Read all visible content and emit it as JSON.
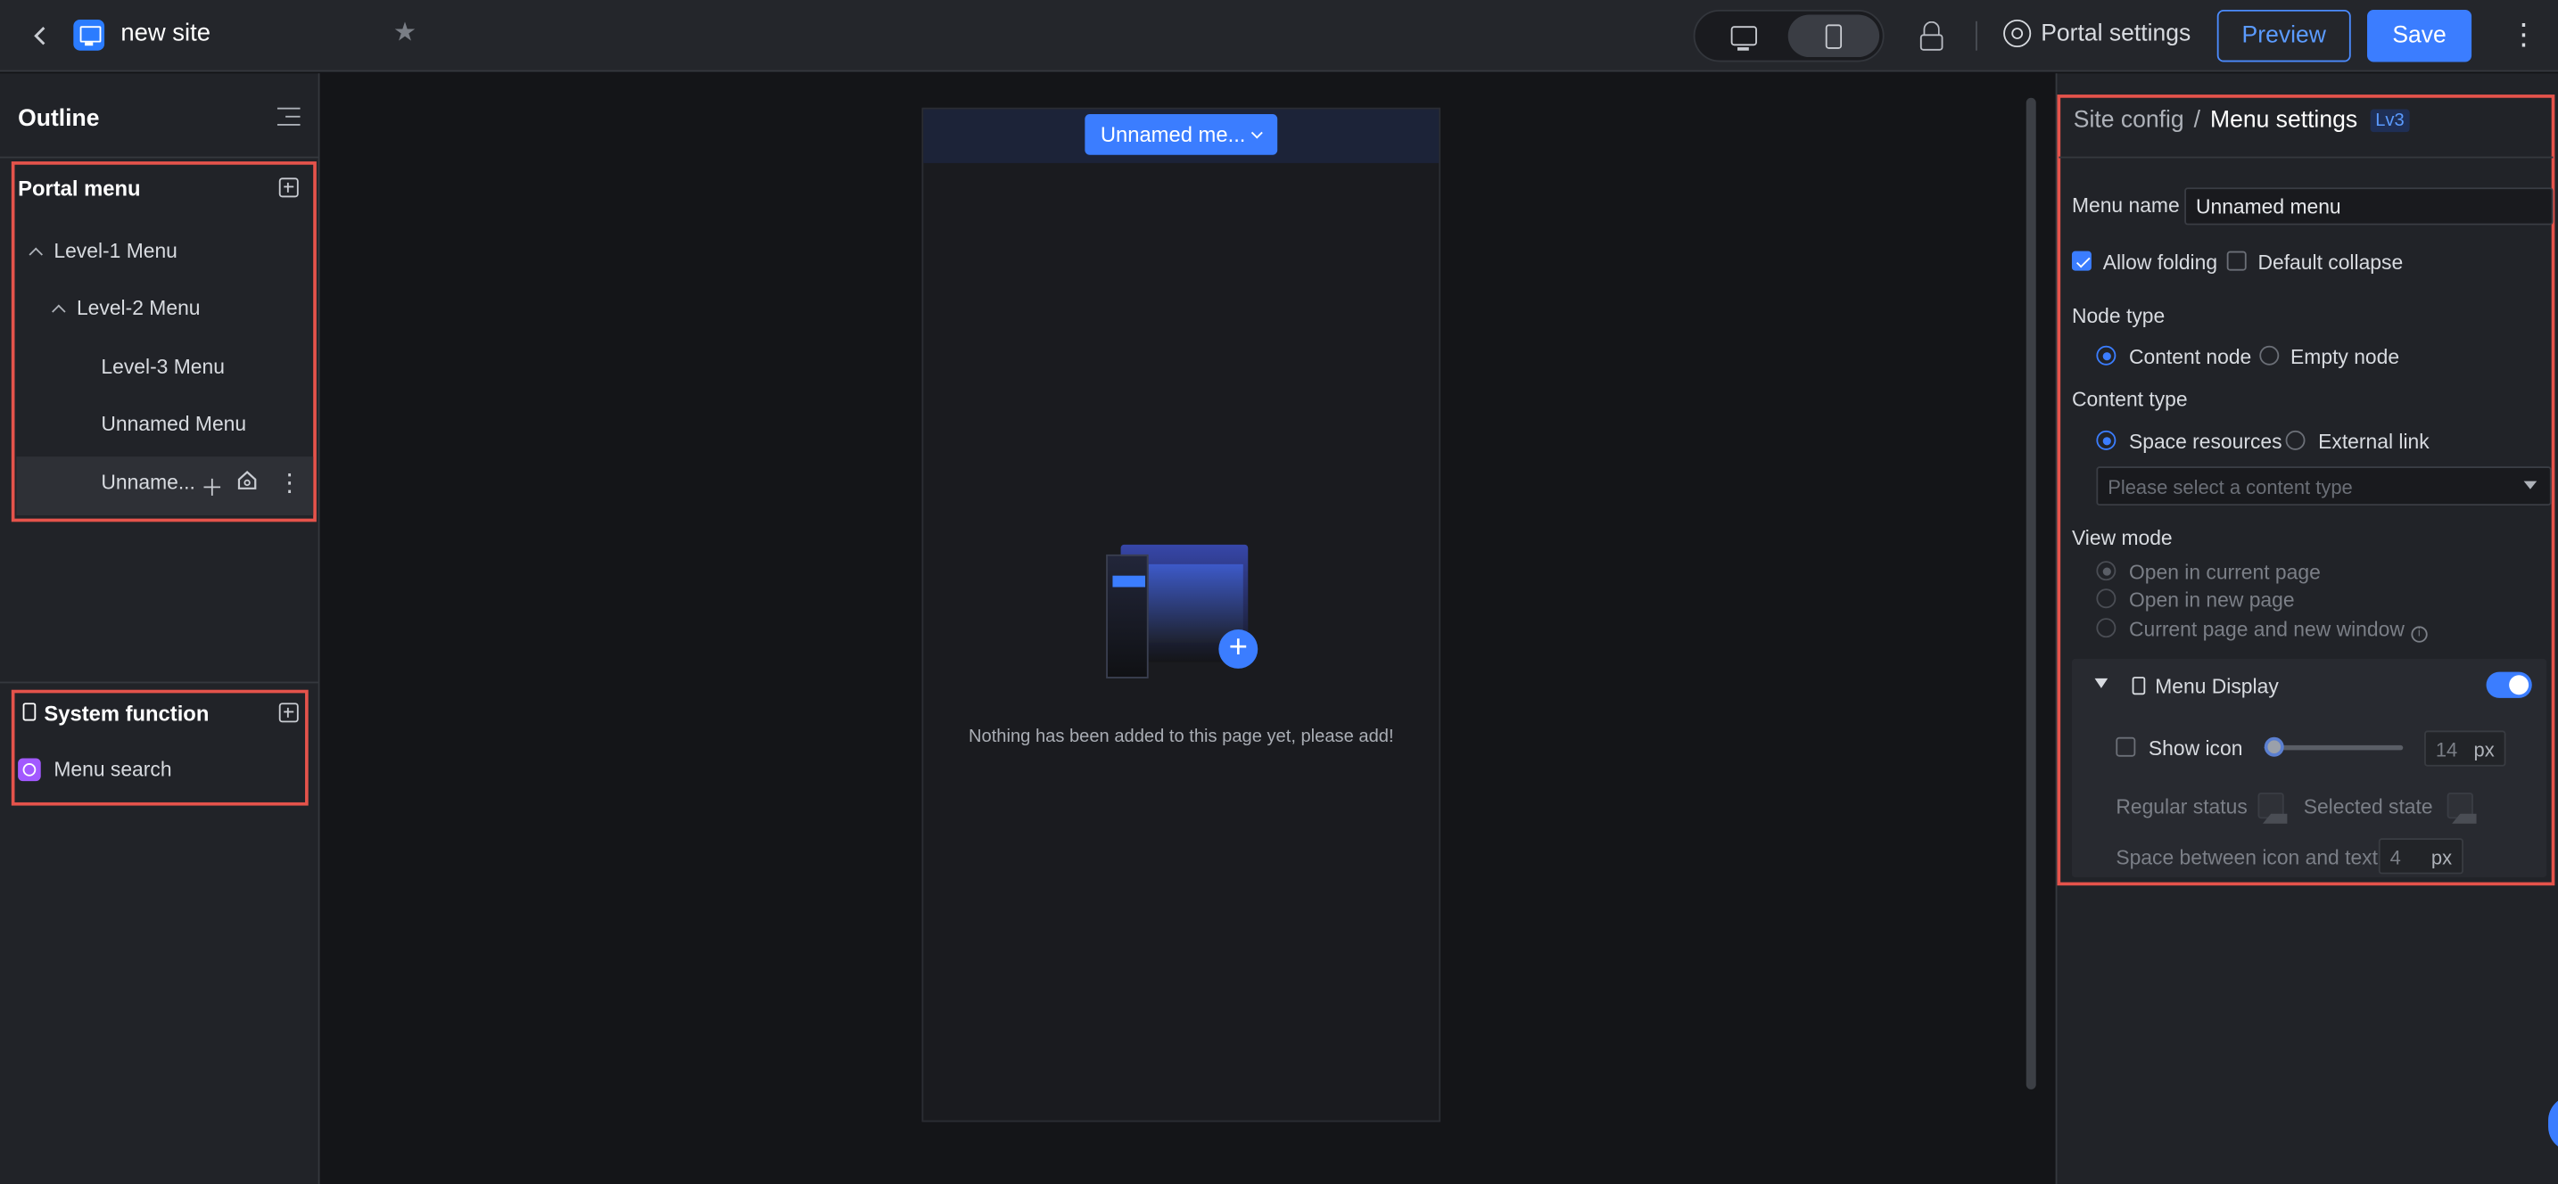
{
  "topbar": {
    "back_icon": "chevron-left-icon",
    "site_title": "new site",
    "star_icon": "star-icon",
    "devices": [
      "desktop-icon",
      "mobile-icon"
    ],
    "active_device": "mobile",
    "settings_label": "Portal settings",
    "preview_label": "Preview",
    "save_label": "Save"
  },
  "outline": {
    "title": "Outline",
    "portal_menu": {
      "title": "Portal menu",
      "items": [
        {
          "label": "Level-1 Menu",
          "level": 1,
          "expanded": true
        },
        {
          "label": "Level-2 Menu",
          "level": 2,
          "expanded": true
        },
        {
          "label": "Level-3 Menu",
          "level": 3
        },
        {
          "label": "Unnamed Menu",
          "level": 3
        },
        {
          "label": "Unname...",
          "level": 3,
          "selected": true
        }
      ]
    },
    "system_function": {
      "title": "System function",
      "items": [
        {
          "label": "Menu search",
          "icon": "search-icon"
        }
      ]
    }
  },
  "canvas": {
    "menu_pill": "Unnamed me...",
    "empty_text": "Nothing has been added to this page yet, please add!"
  },
  "settings": {
    "breadcrumb": {
      "parent": "Site config",
      "separator": "/",
      "current": "Menu settings",
      "level_badge": "Lv3"
    },
    "menu_name_label": "Menu name",
    "menu_name_value": "Unnamed menu",
    "allow_folding_label": "Allow folding",
    "allow_folding_checked": true,
    "default_collapse_label": "Default collapse",
    "default_collapse_checked": false,
    "node_type_label": "Node type",
    "node_type_options": [
      "Content node",
      "Empty node"
    ],
    "node_type_selected": "Content node",
    "content_type_label": "Content type",
    "content_type_options": [
      "Space resources",
      "External link"
    ],
    "content_type_selected": "Space resources",
    "content_type_placeholder": "Please select a content type",
    "view_mode_label": "View mode",
    "view_mode_options": [
      "Open in current page",
      "Open in new page",
      "Current page and new window"
    ],
    "view_mode_selected": "Open in current page",
    "menu_display": {
      "title": "Menu Display",
      "enabled": true,
      "show_icon_label": "Show icon",
      "show_icon_checked": false,
      "icon_size_value": "14",
      "icon_size_unit": "px",
      "regular_status_label": "Regular status",
      "selected_state_label": "Selected state",
      "spacing_label": "Space between icon and text",
      "spacing_value": "4",
      "spacing_unit": "px"
    }
  },
  "colors": {
    "accent": "#3b7dff",
    "highlight_border": "#e5534b",
    "background": "#141518",
    "panel": "#212328"
  }
}
